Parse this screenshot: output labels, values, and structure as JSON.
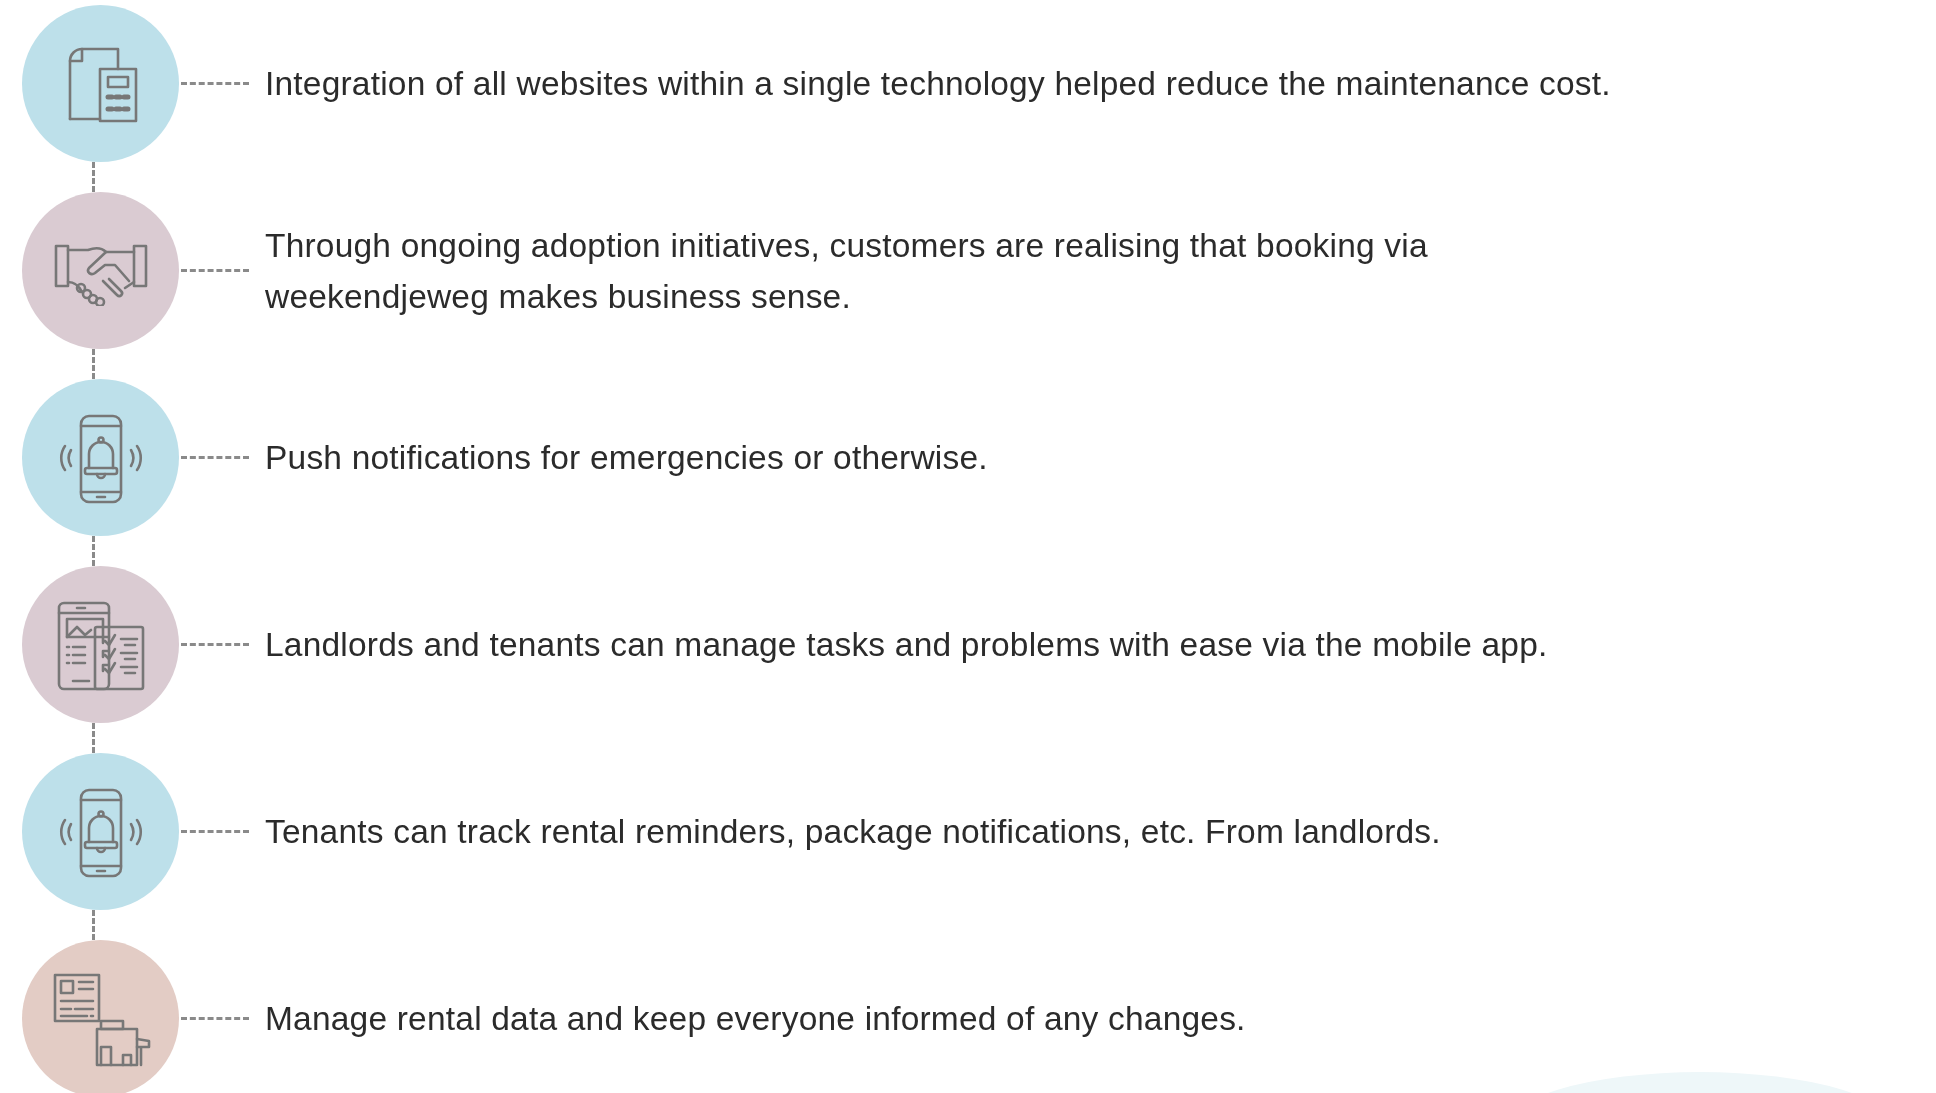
{
  "items": [
    {
      "kind": "document",
      "color": "#bde0ea",
      "lines": [
        "Integration of all websites within a single technology helped reduce the maintenance cost."
      ]
    },
    {
      "kind": "handshake",
      "color": "#dacbd2",
      "lines": [
        "Through ongoing adoption initiatives, customers are realising that booking via",
        "weekendjeweg makes business sense."
      ]
    },
    {
      "kind": "phone-bell",
      "color": "#bde0ea",
      "lines": [
        "Push notifications for emergencies or otherwise."
      ]
    },
    {
      "kind": "checklist",
      "color": "#dacbd2",
      "lines": [
        "Landlords and tenants can manage tasks and problems with ease via the mobile app."
      ]
    },
    {
      "kind": "phone-bell",
      "color": "#bde0ea",
      "lines": [
        "Tenants can track rental reminders, package notifications, etc. From landlords."
      ]
    },
    {
      "kind": "property",
      "color": "#e3ccc5",
      "lines": [
        "Manage rental data and keep everyone informed of any changes."
      ]
    }
  ]
}
